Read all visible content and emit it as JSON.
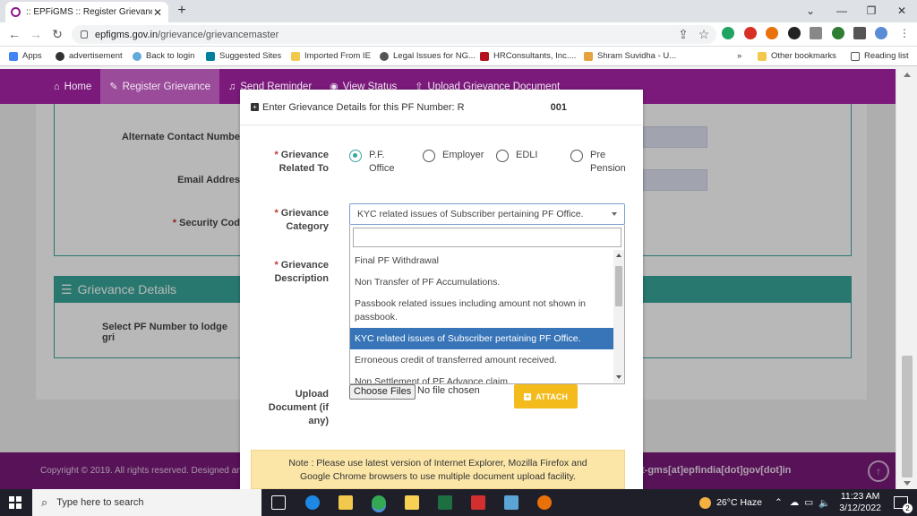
{
  "browser": {
    "tab_title": ":: EPFiGMS :: Register Grievance",
    "new_tab": "+",
    "url_domain": "epfigms.gov.in",
    "url_path": "/grievance/grievancemaster",
    "bookmarks": [
      "Apps",
      "advertisement",
      "Back to login",
      "Suggested Sites",
      "Imported From IE",
      "Legal Issues for NG...",
      "HRConsultants, Inc....",
      "Shram Suvidha - U...",
      "Other bookmarks",
      "Reading list"
    ],
    "bookmarks_more": "»"
  },
  "nav": {
    "items": [
      "Home",
      "Register Grievance",
      "Send Reminder",
      "View Status",
      "Upload Grievance Document"
    ]
  },
  "background_form": {
    "alternate_contact_label": "Alternate Contact Numbe",
    "email_label": "Email Addres",
    "security_code_label": "Security Cod",
    "section_title": "Grievance Details",
    "select_pf_label": "Select PF Number to lodge gri"
  },
  "modal": {
    "header": "Enter Grievance Details for this PF Number: R",
    "pf_suffix": "001",
    "related_to_label": [
      "Grievance",
      "Related To"
    ],
    "category_label": [
      "Grievance",
      "Category"
    ],
    "description_label": [
      "Grievance",
      "Description"
    ],
    "upload_label": [
      "Upload",
      "Document (if",
      "any)"
    ],
    "required_mark": "*",
    "radio_options": [
      {
        "label": [
          "P.F.",
          "Office"
        ],
        "checked": true
      },
      {
        "label": [
          "Employer"
        ],
        "checked": false
      },
      {
        "label": [
          "EDLI"
        ],
        "checked": false
      },
      {
        "label": [
          "Pre",
          "Pension"
        ],
        "checked": false
      }
    ],
    "selected_category": "KYC related issues of Subscriber pertaining PF Office.",
    "dropdown_options": [
      "Final PF Withdrawal",
      "Non Transfer of PF Accumulations.",
      "Passbook related issues including amount not shown in passbook.",
      "KYC related issues of Subscriber pertaining PF Office.",
      "Erroneous credit of transferred amount received.",
      "Non Settlement of PF Advance claim."
    ],
    "choose_files": "Choose Files",
    "no_file": "No file chosen",
    "attach": "ATTACH",
    "note_line1": "Note : Please use latest version of Internet Explorer, Mozilla Firefox and",
    "note_line2": "Google Chrome browsers to use multiple document upload facility."
  },
  "footer": {
    "copyright": "Copyright © 2019. All rights reserved. Designed and",
    "email": "ort-gms[at]epfindia[dot]gov[dot]in"
  },
  "taskbar": {
    "search_placeholder": "Type here to search",
    "weather": "26°C  Haze",
    "time": "11:23 AM",
    "date": "3/12/2022",
    "notification_count": "2"
  },
  "colors": {
    "nav_purple": "#7b1a7b",
    "teal": "#3aa79b",
    "selected_blue": "#3875b8",
    "attach_yellow": "#f3bb1c"
  }
}
